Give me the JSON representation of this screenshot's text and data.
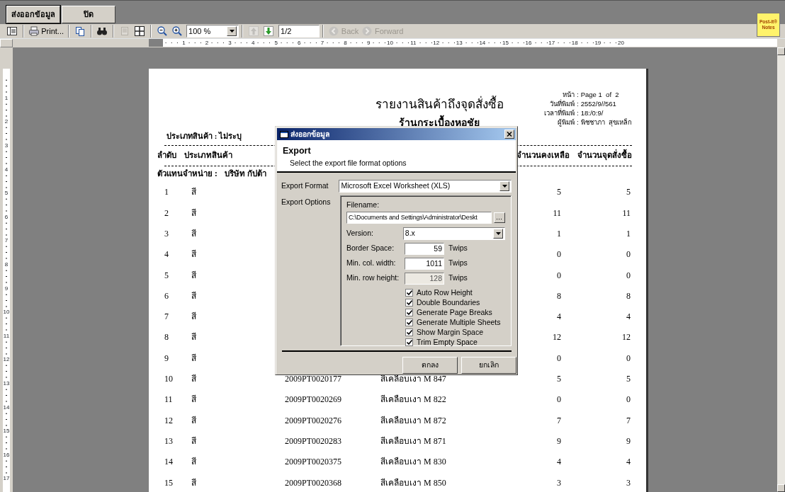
{
  "top_buttons": [
    {
      "label": "ส่งออกข้อมูล",
      "default": true
    },
    {
      "label": "ปิด",
      "default": false
    }
  ],
  "post_it": {
    "line_1": "Post-it®",
    "line_2": "Notes"
  },
  "toolbar": {
    "groups": [
      [
        {
          "kind": "tree-toggle",
          "disabled": false
        }
      ],
      [
        {
          "kind": "print",
          "label": "Print...",
          "disabled": false
        }
      ],
      [
        {
          "kind": "copy",
          "disabled": false
        }
      ],
      [
        {
          "kind": "find",
          "disabled": false
        }
      ],
      [
        {
          "kind": "page-single",
          "disabled": true
        },
        {
          "kind": "page-multi",
          "disabled": false
        }
      ],
      [
        {
          "kind": "zoom-out",
          "disabled": false
        },
        {
          "kind": "zoom-in",
          "disabled": false
        },
        {
          "kind": "zoom-combo",
          "value": "100 %",
          "disabled": false
        }
      ],
      [
        {
          "kind": "page-up",
          "disabled": true
        },
        {
          "kind": "page-down",
          "disabled": false
        },
        {
          "kind": "page-field",
          "value": "1/2"
        }
      ],
      [
        {
          "kind": "back",
          "label": "Back",
          "disabled": true
        },
        {
          "kind": "forward",
          "label": "Forward",
          "disabled": true
        }
      ]
    ]
  },
  "ruler": {
    "horizontal": [
      "1",
      "2",
      "3",
      "4",
      "5",
      "6",
      "7",
      "8",
      "9",
      "10",
      "11",
      "12",
      "13",
      "14",
      "15",
      "16",
      "17",
      "18",
      "19",
      "20"
    ],
    "vertical": [
      "1",
      "2",
      "3",
      "4",
      "5",
      "6",
      "7",
      "8",
      "9",
      "10",
      "11",
      "12",
      "13",
      "14",
      "15",
      "16",
      "17"
    ]
  },
  "report": {
    "title": "รายงานสินค้าถึงจุดสั่งซื้อ",
    "subtitle": "ร้านกระเบื้องหอชัย",
    "info": [
      {
        "label": "หน้า :",
        "value": "Page 1  of  2"
      },
      {
        "label": "วันที่พิมพ์ :",
        "value": "2552/9//561"
      },
      {
        "label": "เวลาที่พิมพ์ :",
        "value": "18:/0:9/"
      },
      {
        "label": "ผู้พิมพ์ :",
        "value": "พิชชาภา  สุขเหล็ก"
      }
    ],
    "filter": "ประเภทสินค้า : ไม่ระบุ",
    "columns": [
      "ลำดับ",
      "ประเภทสินค้า",
      "จำนวนคงเหลือ",
      "จำนวนจุดสั่งซื้อ"
    ],
    "group_label": "ตัวแทนจำหน่าย :",
    "group_value": "บริษัท กัปต้า",
    "rows": [
      {
        "no": "1",
        "type": "สี",
        "remaining": "5",
        "reorder": "5"
      },
      {
        "no": "2",
        "type": "สี",
        "remaining": "11",
        "reorder": "11"
      },
      {
        "no": "3",
        "type": "สี",
        "remaining": "1",
        "reorder": "1"
      },
      {
        "no": "4",
        "type": "สี",
        "remaining": "0",
        "reorder": "0"
      },
      {
        "no": "5",
        "type": "สี",
        "remaining": "0",
        "reorder": "0"
      },
      {
        "no": "6",
        "type": "สี",
        "remaining": "8",
        "reorder": "8"
      },
      {
        "no": "7",
        "type": "สี",
        "remaining": "4",
        "reorder": "4"
      },
      {
        "no": "8",
        "type": "สี",
        "remaining": "12",
        "reorder": "12"
      },
      {
        "no": "9",
        "type": "สี",
        "remaining": "0",
        "reorder": "0"
      },
      {
        "no": "10",
        "type": "สี",
        "code": "2009PT0020177",
        "name": "สีเคลือบเงา M 847",
        "remaining": "5",
        "reorder": "5"
      },
      {
        "no": "11",
        "type": "สี",
        "code": "2009PT0020269",
        "name": "สีเคลือบเงา M 822",
        "remaining": "0",
        "reorder": "0"
      },
      {
        "no": "12",
        "type": "สี",
        "code": "2009PT0020276",
        "name": "สีเคลือบเงา M 872",
        "remaining": "7",
        "reorder": "7"
      },
      {
        "no": "13",
        "type": "สี",
        "code": "2009PT0020283",
        "name": "สีเคลือบเงา M 871",
        "remaining": "9",
        "reorder": "9"
      },
      {
        "no": "14",
        "type": "สี",
        "code": "2009PT0020375",
        "name": "สีเคลือบเงา M 830",
        "remaining": "4",
        "reorder": "4"
      },
      {
        "no": "15",
        "type": "สี",
        "code": "2009PT0020368",
        "name": "สีเคลือบเงา M 850",
        "remaining": "3",
        "reorder": "3"
      }
    ]
  },
  "dialog": {
    "title": "ส่งออกข้อมูล",
    "heading": "Export",
    "description": "Select the export file format options",
    "format_label": "Export Format",
    "format_value": "Microsoft Excel Worksheet (XLS)",
    "options_label": "Export Options",
    "filename_label": "Filename:",
    "filename_value": "C:\\Documents and Settings\\Administrator\\Deskt",
    "version_label": "Version:",
    "version_value": "8.x",
    "fields": [
      {
        "label": "Border Space:",
        "value": "59",
        "unit": "Twips",
        "disabled": false
      },
      {
        "label": "Min. col. width:",
        "value": "1011",
        "unit": "Twips",
        "disabled": false
      },
      {
        "label": "Min. row height:",
        "value": "128",
        "unit": "Twips",
        "disabled": true
      }
    ],
    "checkboxes": [
      {
        "label": "Auto Row Height",
        "checked": true
      },
      {
        "label": "Double Boundaries",
        "checked": true
      },
      {
        "label": "Generate Page Breaks",
        "checked": true
      },
      {
        "label": "Generate Multiple Sheets",
        "checked": true
      },
      {
        "label": "Show Margin Space",
        "checked": true
      },
      {
        "label": "Trim Empty Space",
        "checked": true
      }
    ],
    "buttons": [
      "ตกลง",
      "ยกเลิก"
    ]
  }
}
